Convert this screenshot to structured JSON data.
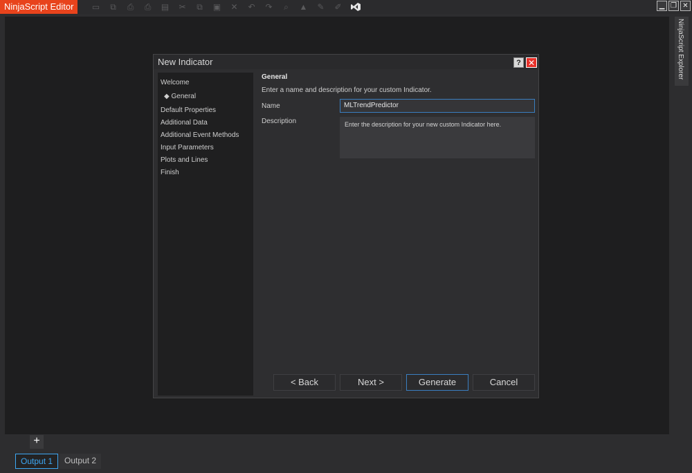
{
  "app": {
    "title": "NinjaScript Editor",
    "accent_color": "#e8431c"
  },
  "toolbar": {
    "icons": [
      "save-icon",
      "save-all-icon",
      "print-icon",
      "print-preview-icon",
      "template-icon",
      "cut-icon",
      "copy-icon",
      "paste-icon",
      "delete-icon",
      "undo-icon",
      "redo-icon",
      "find-icon",
      "compile-icon",
      "comment-icon",
      "uncomment-icon",
      "visual-studio-icon"
    ]
  },
  "window_controls": {
    "minimize": "▁",
    "restore": "❐",
    "close": "✕"
  },
  "side_panel": {
    "label": "NinjaScript Explorer"
  },
  "output": {
    "add_label": "+",
    "tabs": [
      {
        "label": "Output 1",
        "active": true
      },
      {
        "label": "Output 2",
        "active": false
      }
    ]
  },
  "dialog": {
    "title": "New Indicator",
    "help_label": "?",
    "close_label": "✕",
    "nav": {
      "items": [
        "Welcome",
        "General",
        "Default Properties",
        "Additional Data",
        "Additional Event Methods",
        "Input Parameters",
        "Plots and Lines",
        "Finish"
      ],
      "current_marker": "◆"
    },
    "section_title": "General",
    "section_desc": "Enter a name and description for your custom Indicator.",
    "name_label": "Name",
    "name_value": "MLTrendPredictor",
    "description_label": "Description",
    "description_value": "Enter the description for your new custom Indicator here.",
    "buttons": {
      "back": "< Back",
      "next": "Next >",
      "generate": "Generate",
      "cancel": "Cancel"
    }
  }
}
